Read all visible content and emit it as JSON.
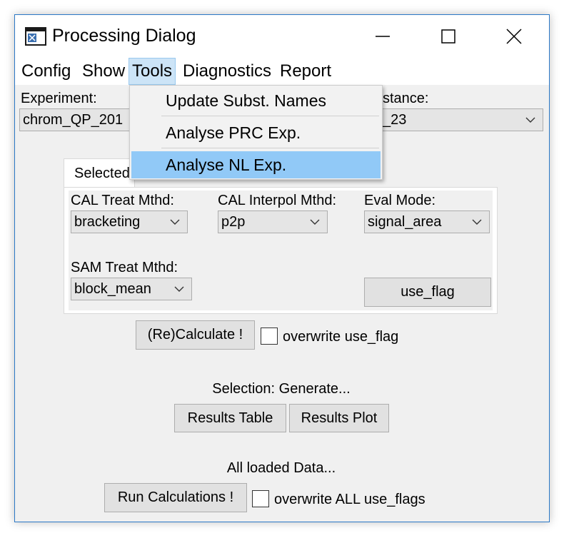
{
  "window": {
    "title": "Processing Dialog"
  },
  "menubar": {
    "items": [
      "Config",
      "Show",
      "Tools",
      "Diagnostics",
      "Report"
    ],
    "active": "Tools"
  },
  "tools_menu": {
    "items": [
      "Update Subst. Names",
      "Analyse PRC Exp.",
      "Analyse NL Exp."
    ],
    "highlighted": "Analyse NL Exp."
  },
  "experiment": {
    "label": "Experiment:",
    "value": "chrom_QP_201"
  },
  "substance": {
    "label": "stance:",
    "value": "_23"
  },
  "tab": {
    "label": "Selected"
  },
  "cal_treat": {
    "label": "CAL Treat Mthd:",
    "value": "bracketing"
  },
  "cal_interpol": {
    "label": "CAL Interpol Mthd:",
    "value": "p2p"
  },
  "eval_mode": {
    "label": "Eval Mode:",
    "value": "signal_area"
  },
  "sam_treat": {
    "label": "SAM Treat Mthd:",
    "value": "block_mean"
  },
  "use_flag_button": "use_flag",
  "recalculate_button": "(Re)Calculate !",
  "overwrite_use_flag_label": "overwrite use_flag",
  "selection_label": "Selection: Generate...",
  "results_table_button": "Results Table",
  "results_plot_button": "Results Plot",
  "all_loaded_label": "All loaded Data...",
  "run_calculations_button": "Run Calculations !",
  "overwrite_all_label": "overwrite ALL use_flags"
}
